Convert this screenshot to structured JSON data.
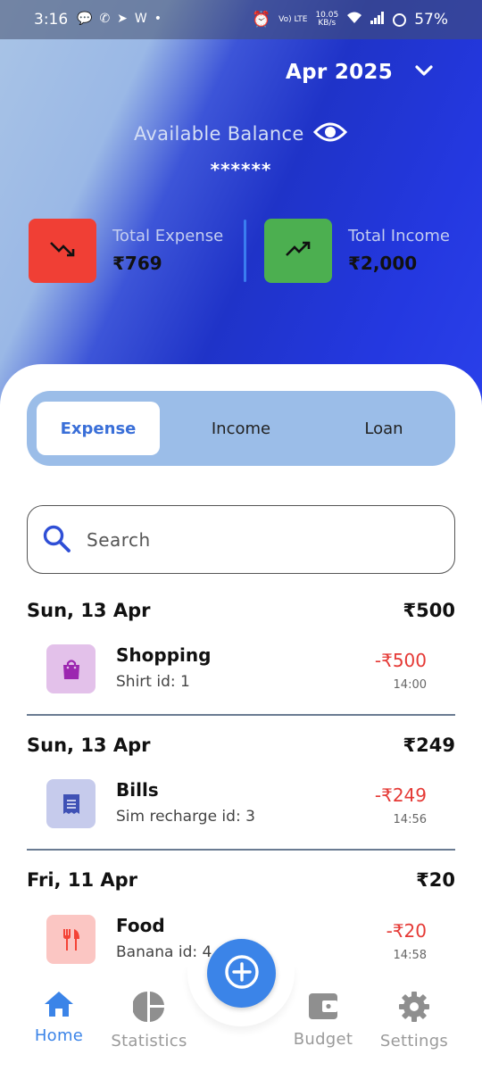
{
  "status_bar": {
    "time": "3:16",
    "net_speed_top": "10.05",
    "net_speed_unit": "KB/s",
    "lte_label": "Vo) LTE",
    "battery": "57%"
  },
  "header": {
    "month": "Apr 2025",
    "balance_label": "Available Balance",
    "balance_value": "******",
    "total_expense_label": "Total Expense",
    "total_expense_value": "₹769",
    "total_income_label": "Total Income",
    "total_income_value": "₹2,000"
  },
  "tabs": [
    {
      "label": "Expense",
      "active": true
    },
    {
      "label": "Income",
      "active": false
    },
    {
      "label": "Loan",
      "active": false
    }
  ],
  "search": {
    "placeholder": "Search",
    "value": ""
  },
  "days": [
    {
      "date": "Sun, 13 Apr",
      "total": "₹500",
      "transactions": [
        {
          "category": "Shopping",
          "note": "Shirt  id: 1",
          "amount": "-₹500",
          "time": "14:00",
          "icon": "shopping-bag-icon",
          "icon_bg": "#e3c1ea",
          "icon_color": "#9c27b0"
        }
      ]
    },
    {
      "date": "Sun, 13 Apr",
      "total": "₹249",
      "transactions": [
        {
          "category": "Bills",
          "note": "Sim recharge  id: 3",
          "amount": "-₹249",
          "time": "14:56",
          "icon": "receipt-icon",
          "icon_bg": "#c6cbec",
          "icon_color": "#3f51b5"
        }
      ]
    },
    {
      "date": "Fri, 11 Apr",
      "total": "₹20",
      "transactions": [
        {
          "category": "Food",
          "note": "Banana id: 4",
          "amount": "-₹20",
          "time": "14:58",
          "icon": "restaurant-icon",
          "icon_bg": "#fbc6c3",
          "icon_color": "#f44336"
        }
      ]
    }
  ],
  "bottom_nav": [
    {
      "label": "Home",
      "icon": "home-icon",
      "active": true
    },
    {
      "label": "Statistics",
      "icon": "pie-chart-icon",
      "active": false
    },
    {
      "label": "Budget",
      "icon": "wallet-icon",
      "active": false
    },
    {
      "label": "Settings",
      "icon": "gear-icon",
      "active": false
    }
  ],
  "colors": {
    "accent": "#3b84e8",
    "expense_red": "#f03f35",
    "income_green": "#4caf50",
    "amount_negative": "#e53935"
  }
}
